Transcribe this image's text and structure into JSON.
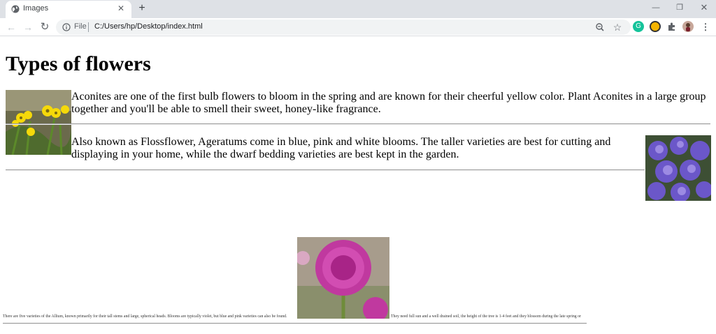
{
  "browser": {
    "tab_title": "Images",
    "omnibox_scheme": "File",
    "omnibox_url": "C:/Users/hp/Desktop/index.html",
    "new_tab_symbol": "+",
    "icons": [
      "globe-icon",
      "close-icon",
      "back-icon",
      "forward-icon",
      "reload-icon",
      "info-icon",
      "zoom-icon",
      "star-icon",
      "grammarly-icon",
      "extension-icon",
      "puzzle-icon",
      "avatar",
      "menu-icon",
      "minimize-icon",
      "restore-icon",
      "window-close-icon"
    ]
  },
  "page": {
    "title": "Types of flowers",
    "aconite_text": "Aconites are one of the first bulb flowers to bloom in the spring and are known for their cheerful yellow color. Plant Aconites in a large group together and you'll be able to smell their sweet, honey-like fragrance.",
    "ageratum_text": "Also known as Flossflower, Ageratums come in blue, pink and white blooms. The taller varieties are best for cutting and displaying in your home, while the dwarf bedding varieties are best kept in the garden.",
    "allium_text_left": "There are five varieties of the Allium, known primarily for their tall stems and large, spherical heads. Blooms are typically violet, but blue and pink varieties can also be found.",
    "allium_text_right": "They need full sun and a well drained soil, the height of the tree is 1-4 feet and they blossom during the late spring or"
  },
  "colors": {
    "chrome_bg": "#dee1e6",
    "omnibox_bg": "#f1f3f4",
    "aconite_yellow": "#f5d90a",
    "ageratum_violet": "#6b57c9",
    "allium_magenta": "#c0399f"
  }
}
